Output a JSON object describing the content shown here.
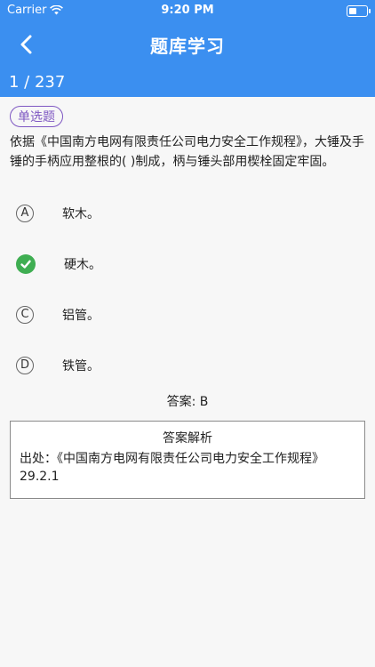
{
  "status_bar": {
    "carrier": "Carrier",
    "time": "9:20 PM"
  },
  "nav": {
    "title": "题库学习",
    "progress": "1 / 237"
  },
  "question": {
    "type_tag": "单选题",
    "text": "依据《中国南方电网有限责任公司电力安全工作规程》，大锤及手锤的手柄应用整根的(    )制成，柄与锤头部用楔栓固定牢固。"
  },
  "options": [
    {
      "letter": "A",
      "text": "软木。",
      "correct": false
    },
    {
      "letter": "B",
      "text": "硬木。",
      "correct": true
    },
    {
      "letter": "C",
      "text": "铝管。",
      "correct": false
    },
    {
      "letter": "D",
      "text": "铁管。",
      "correct": false
    }
  ],
  "answer_line": "答案: B",
  "explanation": {
    "title": "答案解析",
    "body": "出处：《中国南方电网有限责任公司电力安全工作规程》29.2.1"
  },
  "colors": {
    "header": "#3b8ff0",
    "tag": "#7e57c2",
    "correct": "#3fae52"
  }
}
